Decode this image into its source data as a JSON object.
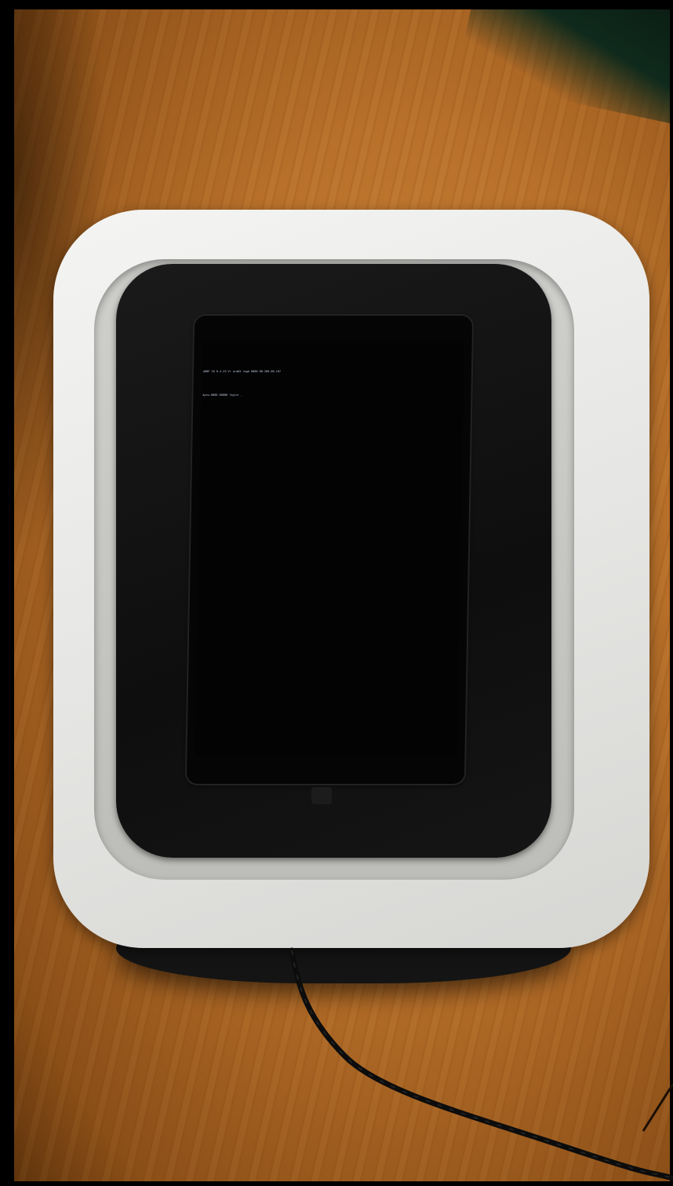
{
  "scene": {
    "description_role": "photo of a phone resting in a white and black wireless charging dock on a wooden desk",
    "phone_screen": {
      "console_lines": [
        "AHBP 10 0.4.43-V+ arm64 rmgb 0000 00.200.00.107",
        "Apnu-0000 00000 ?ogin+ _"
      ]
    },
    "colors": {
      "desk": "#b8702a",
      "dock_outer": "#e6e6e4",
      "dock_pad": "#111111",
      "screen_text": "#b9c4d6"
    }
  }
}
